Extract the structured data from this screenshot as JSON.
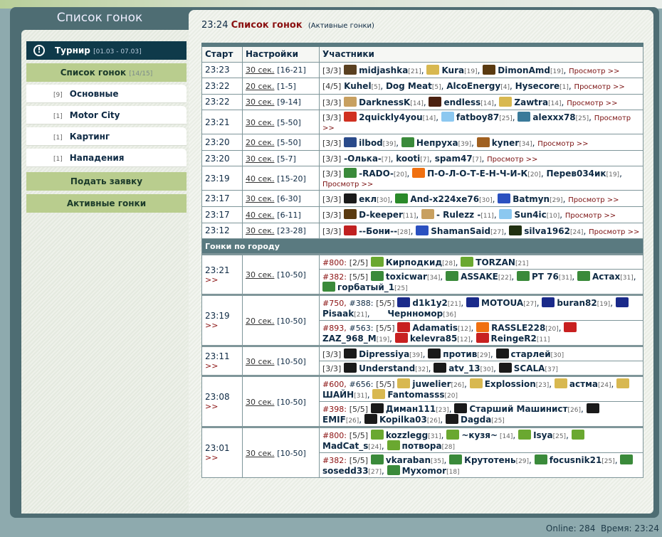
{
  "app": {
    "panel_title": "Список гонок"
  },
  "sidebar": {
    "tournament": {
      "label": "Турнир",
      "dates": "[01.03 - 07.03]",
      "icon": "alert-icon"
    },
    "race_list": {
      "label": "Список гонок",
      "count": "[14/15]"
    },
    "categories": [
      {
        "count": "[9]",
        "label": "Основные"
      },
      {
        "count": "[1]",
        "label": "Motor City"
      },
      {
        "count": "[1]",
        "label": "Картинг"
      },
      {
        "count": "[1]",
        "label": "Нападения"
      }
    ],
    "apply": "Подать заявку",
    "active": "Активные гонки"
  },
  "header": {
    "time": "23:24",
    "title": "Список гонок",
    "subtitle": "(Активные гонки)"
  },
  "table": {
    "headers": [
      "Старт",
      "Настройки",
      "Участники"
    ],
    "view_label": "Просмотр >>",
    "section_city": "Гонки по городу",
    "expand": ">>"
  },
  "avatar_colors": {
    "pirate": "#5a4020",
    "coin": "#d8b850",
    "shield": "#5a3a10",
    "cat": "#c8a060",
    "mask": "#4a2010",
    "red": "#d03020",
    "sky": "#8cc8f0",
    "tera": "#3a7a9a",
    "ford": "#2a4a8a",
    "greenball": "#3a8a3a",
    "lion": "#a06020",
    "sun": "#f07010",
    "feather": "#1a1a1a",
    "ars": "#2a8a2a",
    "ukr": "#2a50c0",
    "flag": "#c02020",
    "tree": "#203010",
    "leaf": "#6aa830",
    "bluex": "#1a2a8a",
    "blank": "#ffffff",
    "redx": "#c82020",
    "skull": "#1a1a1a"
  },
  "races": [
    {
      "time": "23:23",
      "setting": "30 сек.",
      "range": "[16-21]",
      "count": "[3/3]",
      "p": [
        {
          "a": "pirate",
          "n": "midjashka",
          "l": "[21]"
        },
        {
          "a": "coin",
          "n": "Kura",
          "l": "[19]"
        },
        {
          "a": "shield",
          "n": "DimonAmd",
          "l": "[19]"
        }
      ]
    },
    {
      "time": "23:22",
      "setting": "20 сек.",
      "range": "[1-5]",
      "count": "[4/5]",
      "p": [
        {
          "n": "Kuhel",
          "l": "[5]"
        },
        {
          "n": "Dog Meat",
          "l": "[5]"
        },
        {
          "n": "AlcoEnergy",
          "l": "[4]"
        },
        {
          "n": "Hysecore",
          "l": "[1]"
        }
      ]
    },
    {
      "time": "23:22",
      "setting": "30 сек.",
      "range": "[9-14]",
      "count": "[3/3]",
      "p": [
        {
          "a": "cat",
          "n": "DarknessK",
          "l": "[14]"
        },
        {
          "a": "mask",
          "n": "endless",
          "l": "[14]"
        },
        {
          "a": "coin",
          "n": "Zawtra",
          "l": "[14]"
        }
      ]
    },
    {
      "time": "23:21",
      "setting": "30 сек.",
      "range": "[5-50]",
      "count": "[3/3]",
      "p": [
        {
          "a": "red",
          "n": "2quickly4you",
          "l": "[14]"
        },
        {
          "a": "sky",
          "n": "fatboy87",
          "l": "[25]"
        },
        {
          "a": "tera",
          "n": "alexxx78",
          "l": "[25]"
        }
      ]
    },
    {
      "time": "23:20",
      "setting": "20 сек.",
      "range": "[5-50]",
      "count": "[3/3]",
      "p": [
        {
          "a": "ford",
          "n": "ilbod",
          "l": "[39]"
        },
        {
          "a": "greenball",
          "n": "Непруха",
          "l": "[39]"
        },
        {
          "a": "lion",
          "n": "kyner",
          "l": "[34]"
        }
      ]
    },
    {
      "time": "23:20",
      "setting": "30 сек.",
      "range": "[5-7]",
      "count": "[3/3]",
      "p": [
        {
          "n": "-Олька-",
          "l": "[7]"
        },
        {
          "n": "kooti",
          "l": "[7]"
        },
        {
          "n": "spam47",
          "l": "[7]"
        }
      ]
    },
    {
      "time": "23:19",
      "setting": "40 сек.",
      "range": "[15-20]",
      "count": "[3/3]",
      "p": [
        {
          "a": "greenball",
          "n": "-RADO-",
          "l": "[20]"
        },
        {
          "a": "sun",
          "n": "П-О-Л-О-Т-Е-Н-Ч-И-К",
          "l": "[20]"
        },
        {
          "n": "Перев034ик",
          "l": "[19]"
        }
      ]
    },
    {
      "time": "23:17",
      "setting": "30 сек.",
      "range": "[6-30]",
      "count": "[3/3]",
      "p": [
        {
          "a": "feather",
          "n": "екл",
          "l": "[30]"
        },
        {
          "a": "ars",
          "n": "And-x224xe76",
          "l": "[30]"
        },
        {
          "a": "ukr",
          "n": "Batmyn",
          "l": "[29]"
        }
      ]
    },
    {
      "time": "23:17",
      "setting": "40 сек.",
      "range": "[6-11]",
      "count": "[3/3]",
      "p": [
        {
          "a": "shield",
          "n": "D-keeper",
          "l": "[11]"
        },
        {
          "a": "cat",
          "n": "- Rulezz -",
          "l": "[11]"
        },
        {
          "a": "sky",
          "n": "Sun4ic",
          "l": "[10]"
        }
      ]
    },
    {
      "time": "23:12",
      "setting": "30 сек.",
      "range": "[23-28]",
      "count": "[3/3]",
      "p": [
        {
          "a": "flag",
          "n": "--Бони--",
          "l": "[28]"
        },
        {
          "a": "ukr",
          "n": "ShamanSaid",
          "l": "[27]"
        },
        {
          "a": "tree",
          "n": "silva1962",
          "l": "[24]"
        }
      ]
    }
  ],
  "city_races": [
    {
      "time": "23:21",
      "setting": "30 сек.",
      "range": "[10-50]",
      "groups": [
        {
          "clans": [
            "#800:"
          ],
          "count": "[2/5]",
          "p": [
            {
              "a": "leaf",
              "n": "Кирподкид",
              "l": "[28]"
            },
            {
              "a": "leaf",
              "n": "TORZAN",
              "l": "[21]"
            }
          ]
        },
        {
          "clans": [
            "#382:"
          ],
          "count": "[5/5]",
          "p": [
            {
              "a": "greenball",
              "n": "toxicwar",
              "l": "[34]"
            },
            {
              "a": "greenball",
              "n": "ASSAKE",
              "l": "[22]"
            },
            {
              "a": "greenball",
              "n": "PT 76",
              "l": "[31]"
            },
            {
              "a": "greenball",
              "n": "Астах",
              "l": "[31]"
            },
            {
              "a": "greenball",
              "n": "горбатый_1",
              "l": "[25]"
            }
          ]
        }
      ]
    },
    {
      "time": "23:19",
      "setting": "20 сек.",
      "range": "[10-50]",
      "groups": [
        {
          "clans": [
            "#750,",
            "#388:"
          ],
          "count": "[5/5]",
          "p": [
            {
              "a": "bluex",
              "n": "d1k1y2",
              "l": "[21]"
            },
            {
              "a": "bluex",
              "n": "MOTOUA",
              "l": "[27]"
            },
            {
              "a": "bluex",
              "n": "buran82",
              "l": "[19]"
            },
            {
              "a": "bluex",
              "n": "Pisaak",
              "l": "[21]"
            },
            {
              "a": "blank",
              "n": "Чернномор",
              "l": "[36]"
            }
          ]
        },
        {
          "clans": [
            "#893,",
            "#563:"
          ],
          "count": "[5/5]",
          "p": [
            {
              "a": "redx",
              "n": "Adamatis",
              "l": "[12]"
            },
            {
              "a": "sun",
              "n": "RASSLE228",
              "l": "[20]"
            },
            {
              "a": "redx",
              "n": "ZAZ_968_M",
              "l": "[19]"
            },
            {
              "a": "redx",
              "n": "kelevra85",
              "l": "[12]"
            },
            {
              "a": "redx",
              "n": "ReingeR2",
              "l": "[11]"
            }
          ]
        }
      ]
    },
    {
      "time": "23:11",
      "setting": "30 сек.",
      "range": "[10-50]",
      "groups": [
        {
          "clans": [],
          "count": "[3/3]",
          "p": [
            {
              "a": "feather",
              "n": "Dipressiya",
              "l": "[39]"
            },
            {
              "a": "feather",
              "n": "против",
              "l": "[29]"
            },
            {
              "a": "feather",
              "n": "старлей",
              "l": "[30]"
            }
          ]
        },
        {
          "clans": [],
          "count": "[3/3]",
          "p": [
            {
              "a": "feather",
              "n": "Understand",
              "l": "[32]"
            },
            {
              "a": "feather",
              "n": "atv_13",
              "l": "[30]"
            },
            {
              "a": "feather",
              "n": "SCALA",
              "l": "[37]"
            }
          ]
        }
      ]
    },
    {
      "time": "23:08",
      "setting": "30 сек.",
      "range": "[10-50]",
      "groups": [
        {
          "clans": [
            "#600,",
            "#656:"
          ],
          "count": "[5/5]",
          "p": [
            {
              "a": "coin",
              "n": "juwelier",
              "l": "[26]"
            },
            {
              "a": "coin",
              "n": "Explossion",
              "l": "[23]"
            },
            {
              "a": "coin",
              "n": "астма",
              "l": "[24]"
            },
            {
              "a": "coin",
              "n": "ШАЙН",
              "l": "[31]"
            },
            {
              "a": "coin",
              "n": "Fantomasss",
              "l": "[20]"
            }
          ]
        },
        {
          "clans": [
            "#398:"
          ],
          "count": "[5/5]",
          "p": [
            {
              "a": "skull",
              "n": "Диман111",
              "l": "[23]"
            },
            {
              "a": "skull",
              "n": "Старший Машинист",
              "l": "[26]"
            },
            {
              "a": "skull",
              "n": "EMIF",
              "l": "[26]"
            },
            {
              "a": "skull",
              "n": "Kopilka03",
              "l": "[26]"
            },
            {
              "a": "skull",
              "n": "Dagda",
              "l": "[25]"
            }
          ]
        }
      ]
    },
    {
      "time": "23:01",
      "setting": "30 сек.",
      "range": "[10-50]",
      "groups": [
        {
          "clans": [
            "#800:"
          ],
          "count": "[5/5]",
          "p": [
            {
              "a": "leaf",
              "n": "kozzlegg",
              "l": "[31]"
            },
            {
              "a": "leaf",
              "n": "~кузя~",
              "l": " [14]"
            },
            {
              "a": "leaf",
              "n": "Isya",
              "l": "[25]"
            },
            {
              "a": "leaf",
              "n": "MadCat_s",
              "l": "[24]"
            },
            {
              "a": "leaf",
              "n": "потвора",
              "l": "[28]"
            }
          ]
        },
        {
          "clans": [
            "#382:"
          ],
          "count": "[5/5]",
          "p": [
            {
              "a": "greenball",
              "n": "vkaraban",
              "l": "[35]"
            },
            {
              "a": "greenball",
              "n": "Крутотень",
              "l": "[29]"
            },
            {
              "a": "greenball",
              "n": "focusnik21",
              "l": "[25]"
            },
            {
              "a": "greenball",
              "n": "sosedd33",
              "l": "[27]"
            },
            {
              "a": "greenball",
              "n": "Myxomor",
              "l": "[18]"
            }
          ]
        }
      ]
    }
  ],
  "status": {
    "online_label": "Online:",
    "online": "284",
    "time_label": "Время:",
    "time": "23:24"
  }
}
